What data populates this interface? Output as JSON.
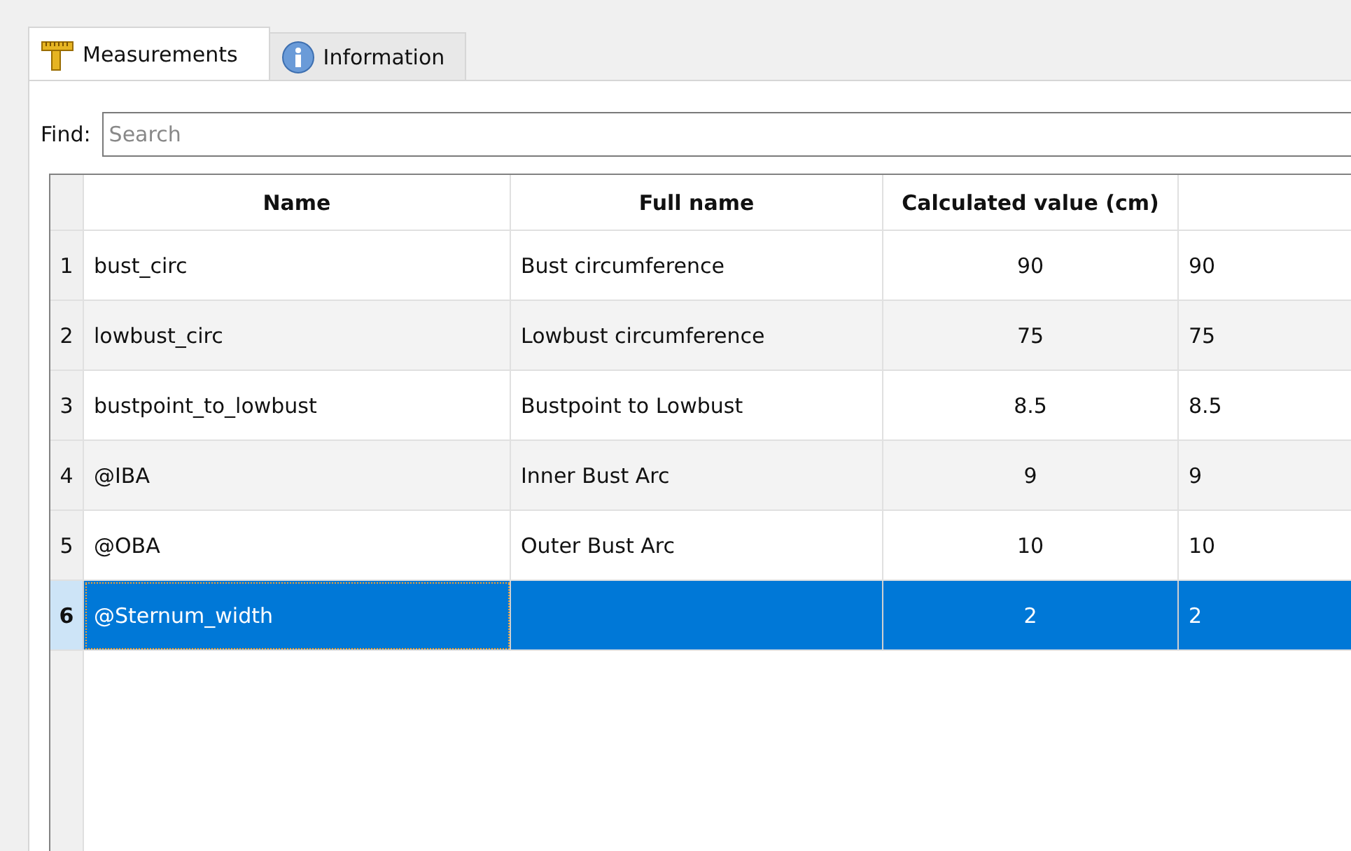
{
  "tabs": [
    {
      "label": "Measurements",
      "kind": "ruler",
      "selected": true
    },
    {
      "label": "Information",
      "kind": "info",
      "selected": false
    }
  ],
  "search": {
    "label": "Find:",
    "placeholder": "Search"
  },
  "table": {
    "columns": [
      "Name",
      "Full name",
      "Calculated value (cm)",
      ""
    ],
    "rows": [
      {
        "number": "1",
        "cells": [
          "bust_circ",
          "Bust circumference",
          "90",
          "90"
        ],
        "selected": false
      },
      {
        "number": "2",
        "cells": [
          "lowbust_circ",
          "Lowbust circumference",
          "75",
          "75"
        ],
        "selected": false
      },
      {
        "number": "3",
        "cells": [
          "bustpoint_to_lowbust",
          "Bustpoint to Lowbust",
          "8.5",
          "8.5"
        ],
        "selected": false
      },
      {
        "number": "4",
        "cells": [
          "@IBA",
          "Inner Bust Arc",
          "9",
          "9"
        ],
        "selected": false
      },
      {
        "number": "5",
        "cells": [
          "@OBA",
          "Outer Bust Arc",
          "10",
          "10"
        ],
        "selected": false
      },
      {
        "number": "6",
        "cells": [
          "@Sternum_width",
          "",
          "2",
          "2"
        ],
        "selected": true
      }
    ]
  }
}
